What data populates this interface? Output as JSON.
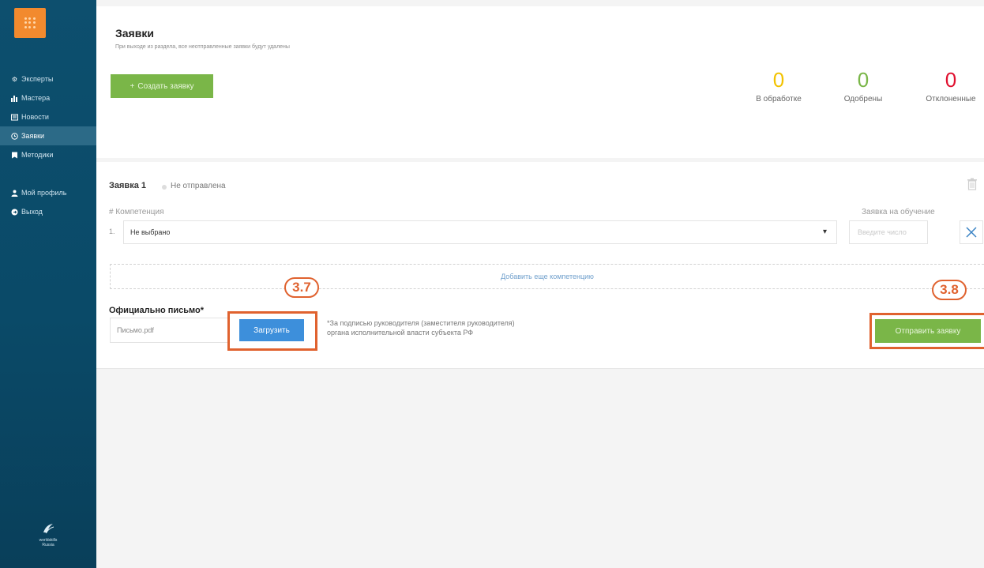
{
  "sidebar": {
    "items": [
      {
        "label": "Эксперты",
        "icon": "gear-icon"
      },
      {
        "label": "Мастера",
        "icon": "bar-chart-icon"
      },
      {
        "label": "Новости",
        "icon": "newspaper-icon"
      },
      {
        "label": "Заявки",
        "icon": "clock-icon"
      },
      {
        "label": "Методики",
        "icon": "bookmark-icon"
      }
    ],
    "profile": {
      "label": "Мой профиль",
      "icon": "user-icon"
    },
    "logout": {
      "label": "Выход",
      "icon": "exit-icon"
    },
    "footer_logo_text": "worldskills Russia"
  },
  "header": {
    "title": "Заявки",
    "subtitle": "При выходе из раздела, все неотправленные заявки будут удалены",
    "create_button": "Создать заявку"
  },
  "stats": [
    {
      "value": "0",
      "label": "В обработке",
      "color": "#f2c200"
    },
    {
      "value": "0",
      "label": "Одобрены",
      "color": "#7ab648"
    },
    {
      "value": "0",
      "label": "Отклоненные",
      "color": "#e0102f"
    }
  ],
  "application": {
    "title": "Заявка 1",
    "status": "Не отправлена",
    "competence_label": "# Компетенция",
    "training_label": "Заявка на обучение",
    "row_number": "1.",
    "competence_value": "Не выбрано",
    "training_placeholder": "Введите число",
    "add_competence": "Добавить еще компетенцию",
    "letter_label": "Официально письмо*",
    "file_name": "Письмо.pdf",
    "upload_button": "Загрузить",
    "note_line1": "*За подписью руководителя (заместителя руководителя)",
    "note_line2": "органа исполнительной власти субъекта РФ",
    "send_button": "Отправить заявку"
  },
  "annotations": {
    "badge_upload": "3.7",
    "badge_send": "3.8",
    "accent": "#e0622f"
  }
}
